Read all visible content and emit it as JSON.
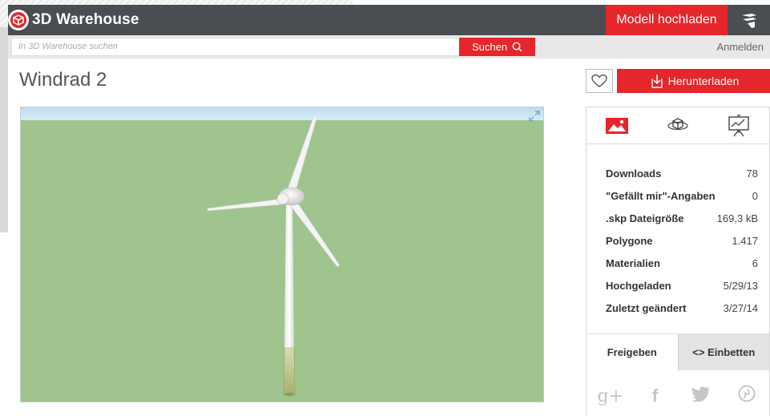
{
  "app": {
    "brand": "3D Warehouse",
    "upload_label": "Modell hochladen",
    "accent": "#e5262a",
    "topbar_color": "#4a4d52"
  },
  "search": {
    "placeholder": "In 3D Warehouse suchen",
    "button_label": "Suchen",
    "signin_label": "Anmelden"
  },
  "model": {
    "title": "Windrad 2",
    "download_label": "Herunterladen"
  },
  "panel": {
    "tabs": [
      {
        "icon": "image-icon"
      },
      {
        "icon": "3d-rotate-icon"
      },
      {
        "icon": "presentation-icon"
      }
    ],
    "stats": [
      {
        "label": "Downloads",
        "value": "78"
      },
      {
        "label": "\"Gefällt mir\"-Angaben",
        "value": "0"
      },
      {
        "label": ".skp Dateigröße",
        "value": "169,3 kB"
      },
      {
        "label": "Polygone",
        "value": "1.417"
      },
      {
        "label": "Materialien",
        "value": "6"
      },
      {
        "label": "Hochgeladen",
        "value": "5/29/13"
      },
      {
        "label": "Zuletzt geändert",
        "value": "3/27/14"
      }
    ],
    "share_tab": "Freigeben",
    "embed_tab": "<> Einbetten",
    "social": [
      {
        "icon": "google-plus-icon",
        "glyph": "g+"
      },
      {
        "icon": "facebook-icon",
        "glyph": "f"
      },
      {
        "icon": "twitter-icon",
        "glyph": "t"
      },
      {
        "icon": "pinterest-icon",
        "glyph": "p"
      }
    ]
  }
}
